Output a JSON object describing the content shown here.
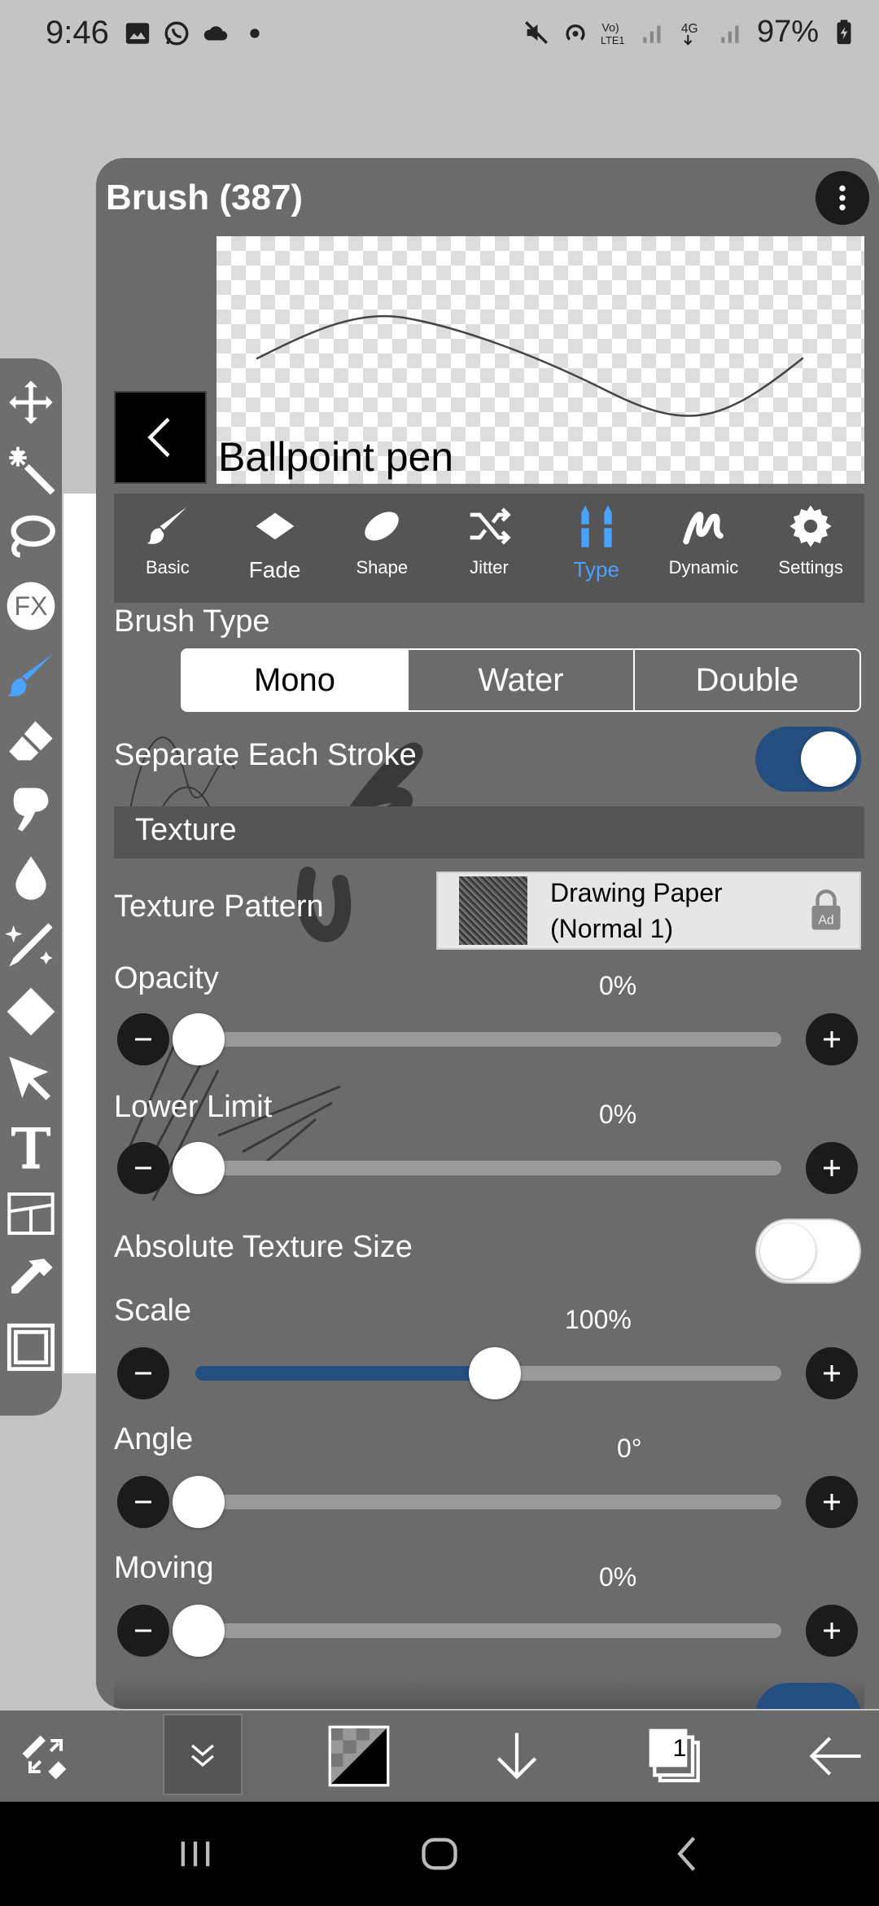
{
  "status_bar": {
    "time": "9:46",
    "battery": "97%",
    "icons": [
      "gallery-icon",
      "whatsapp-icon",
      "cloud-icon",
      "dot-icon",
      "mute-icon",
      "hotspot-icon",
      "volte-icon",
      "signal-icon",
      "4g-icon",
      "signal-icon",
      "battery-icon"
    ]
  },
  "tool_rail": {
    "tools": [
      "move-icon",
      "magic-wand-icon",
      "lasso-icon",
      "fx-icon",
      "brush-icon",
      "eraser-icon",
      "smudge-icon",
      "blur-icon",
      "special-pen-icon",
      "fill-icon",
      "select-icon",
      "text-icon",
      "frame-divider-icon",
      "eyedropper-icon",
      "canvas-icon"
    ],
    "fx_label": "FX",
    "active_tool": "brush-icon"
  },
  "panel": {
    "title": "Brush (387)",
    "brush_name": "Ballpoint pen",
    "tabs": [
      {
        "label": "Basic",
        "icon": "brush-icon"
      },
      {
        "label": "Fade",
        "icon": "diamond-icon"
      },
      {
        "label": "Shape",
        "icon": "ellipse-icon"
      },
      {
        "label": "Jitter",
        "icon": "shuffle-icon"
      },
      {
        "label": "Type",
        "icon": "type-icon"
      },
      {
        "label": "Dynamic",
        "icon": "dynamic-icon"
      },
      {
        "label": "Settings",
        "icon": "gear-icon"
      }
    ],
    "active_tab": "Type",
    "brush_type": {
      "label": "Brush Type",
      "options": [
        "Mono",
        "Water",
        "Double"
      ],
      "selected": "Mono"
    },
    "separate_each_stroke": {
      "label": "Separate Each Stroke",
      "on": true
    },
    "texture_section": "Texture",
    "texture_pattern": {
      "label": "Texture Pattern",
      "name_line1": "Drawing Paper",
      "name_line2": "(Normal 1)",
      "badge": "Ad"
    },
    "opacity": {
      "label": "Opacity",
      "value_text": "0%",
      "value": 0
    },
    "lower_limit": {
      "label": "Lower Limit",
      "value_text": "0%",
      "value": 0
    },
    "absolute_texture_size": {
      "label": "Absolute Texture Size",
      "on": false
    },
    "scale": {
      "label": "Scale",
      "value_text": "100%",
      "value": 0.5
    },
    "angle": {
      "label": "Angle",
      "value_text": "0°",
      "value": 0
    },
    "moving": {
      "label": "Moving",
      "value_text": "0%",
      "value": 0
    }
  },
  "bottom_bar": {
    "layer_count": "1",
    "buttons": [
      "swap-tool-icon",
      "collapse-icon",
      "color-icon",
      "download-icon",
      "layers-icon",
      "back-arrow-icon"
    ]
  },
  "nav_bar": {
    "buttons": [
      "recents-icon",
      "home-icon",
      "back-icon"
    ]
  }
}
